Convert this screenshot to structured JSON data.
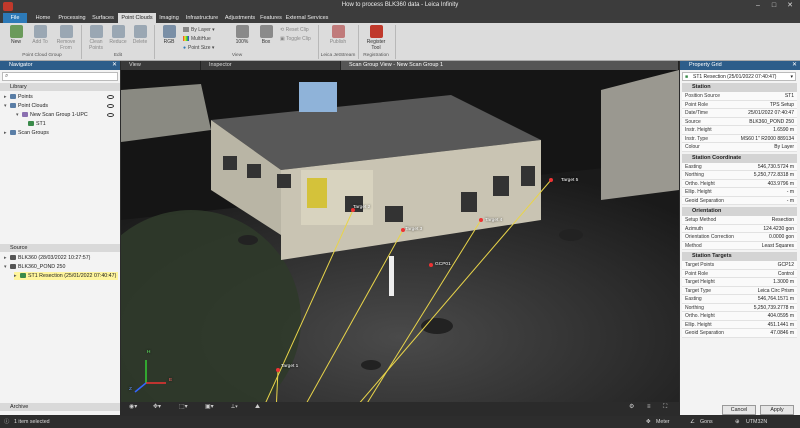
{
  "window": {
    "title": "How to process BLK360 data - Leica Infinity"
  },
  "menu_tabs": [
    {
      "label": "File"
    },
    {
      "label": "Home"
    },
    {
      "label": "Processing"
    },
    {
      "label": "Surfaces"
    },
    {
      "label": "Point Clouds"
    },
    {
      "label": "Imaging"
    },
    {
      "label": "Infrastructure"
    },
    {
      "label": "Adjustments"
    },
    {
      "label": "Features"
    },
    {
      "label": "External Services"
    }
  ],
  "ribbon": {
    "new": "New",
    "add_to": "Add To",
    "remove_from": "Remove From",
    "group_point_cloud_group": "Point Cloud Group",
    "clean_points": "Clean Points",
    "reduce": "Reduce",
    "delete": "Delete",
    "group_edit": "Edit",
    "rgb": "RGB",
    "by_layer": "By Layer",
    "multihue": "MultiHue",
    "point_size": "Point Size",
    "pct": "100%",
    "box": "Box",
    "reset_clip": "Reset Clip",
    "toggle_clip": "Toggle Clip",
    "group_view": "View",
    "publish": "Publish",
    "group_jetstream": "Leica JetStream",
    "register_tool": "Register Tool",
    "group_registration": "Registration"
  },
  "navigator": {
    "title": "Navigator",
    "search_icon": "search-icon",
    "library_label": "Library",
    "items": [
      {
        "label": "Points"
      },
      {
        "label": "Point Clouds"
      },
      {
        "label": "New Scan Group 1-UPC"
      },
      {
        "label": "ST1"
      },
      {
        "label": "Scan Groups"
      }
    ],
    "source_label": "Source",
    "source_items": [
      {
        "label": "BLK360 (28/03/2022 10:27:57)"
      },
      {
        "label": "BLK360_POND 250"
      },
      {
        "label": "ST1 Resection (25/01/2022 07:40:47)"
      }
    ],
    "archive_label": "Archive"
  },
  "viewport": {
    "tabs": [
      {
        "label": "View"
      },
      {
        "label": "Inspector"
      },
      {
        "label": "Scan Group View - New Scan Group 1"
      }
    ],
    "labels": [
      "Target 5",
      "Target 4",
      "Target 3",
      "GCP01",
      "Target 2",
      "Target 1"
    ],
    "axis": {
      "x": "X",
      "y": "Y",
      "z": "Z",
      "h": "H",
      "e": "E"
    }
  },
  "property_grid": {
    "title": "Property Grid",
    "selected": "ST1 Resection (25/01/2022 07:40:47)",
    "sections": {
      "station": "Station",
      "station_coordinate": "Station Coordinate",
      "orientation": "Orientation",
      "station_targets": "Station Targets"
    },
    "station": [
      {
        "k": "Position Source",
        "v": "ST1"
      },
      {
        "k": "Point Role",
        "v": "TPS Setup"
      },
      {
        "k": "Date/Time",
        "v": "25/01/2022 07:40:47"
      },
      {
        "k": "Source",
        "v": "BLK360_POND 250"
      },
      {
        "k": "Instr. Height",
        "v": "1.6590 m"
      },
      {
        "k": "Instr. Type",
        "v": "MS60 1\" R2000 889134"
      },
      {
        "k": "Colour",
        "v": "By Layer"
      }
    ],
    "station_coordinate": [
      {
        "k": "Easting",
        "v": "546,730.5724 m"
      },
      {
        "k": "Northing",
        "v": "5,250,772.8318 m"
      },
      {
        "k": "Ortho. Height",
        "v": "403.9796 m"
      },
      {
        "k": "Ellip. Height",
        "v": "- m"
      },
      {
        "k": "Geoid Separation",
        "v": "- m"
      }
    ],
    "orientation": [
      {
        "k": "Setup Method",
        "v": "Resection"
      },
      {
        "k": "Azimuth",
        "v": "124.4230 gon"
      },
      {
        "k": "Orientation Correction",
        "v": "0.0000 gon"
      },
      {
        "k": "Method",
        "v": "Least Squares"
      }
    ],
    "station_targets": [
      {
        "k": "Target Points",
        "v": "GCP12"
      },
      {
        "k": "Point Role",
        "v": "Control"
      },
      {
        "k": "Target Height",
        "v": "1.3000 m"
      },
      {
        "k": "Target Type",
        "v": "Leica Circ Prism"
      },
      {
        "k": "Easting",
        "v": "546,764.1571 m"
      },
      {
        "k": "Northing",
        "v": "5,250,739.2778 m"
      },
      {
        "k": "Ortho. Height",
        "v": "404.0595 m"
      },
      {
        "k": "Ellip. Height",
        "v": "451.1441 m"
      },
      {
        "k": "Geoid Separation",
        "v": "47.0846 m"
      }
    ],
    "cancel": "Cancel",
    "apply": "Apply"
  },
  "status": {
    "selected": "1 item selected",
    "unit_length": "Meter",
    "unit_angle": "Gons",
    "crs": "UTM32N"
  },
  "colors": {
    "panel_header": "#2d5d8a",
    "file_tab": "#2d7ab8",
    "selection": "#fff59d",
    "target_line": "#e8d44a"
  }
}
